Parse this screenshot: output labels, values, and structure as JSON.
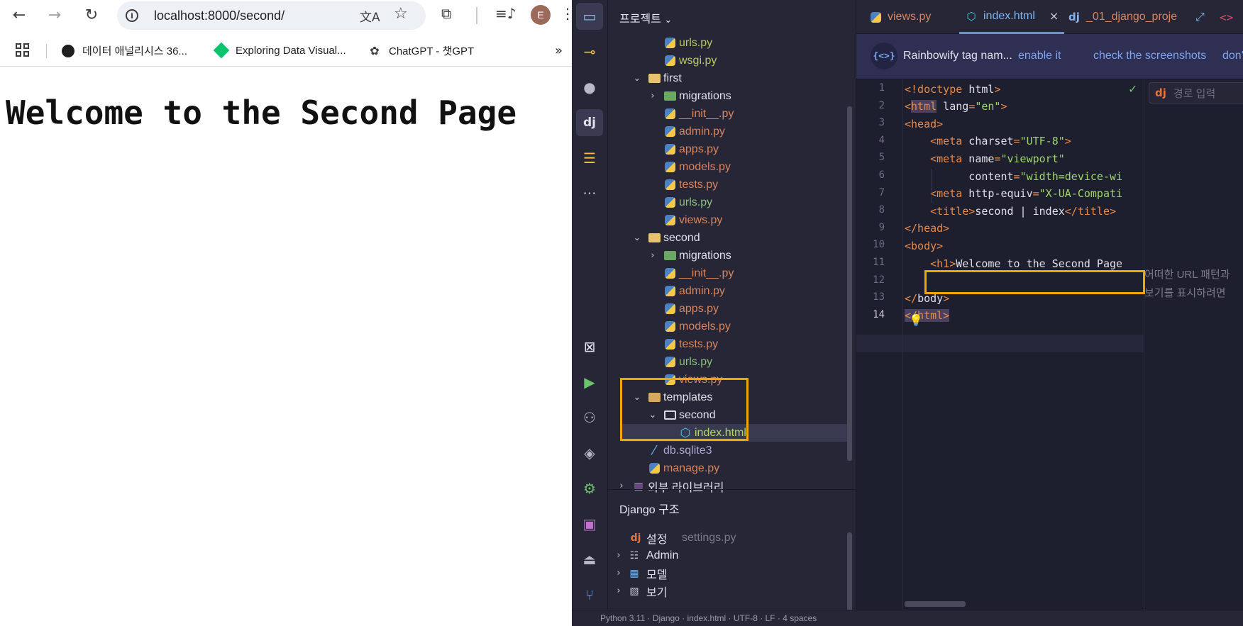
{
  "browser": {
    "url": "localhost:8000/second/",
    "avatar_letter": "E",
    "bookmarks": [
      {
        "label": "데이터 애널리시스 36...",
        "icon": "github-icon"
      },
      {
        "label": "Exploring Data Visual...",
        "icon": "datacamp-icon"
      },
      {
        "label": "ChatGPT - 챗GPT",
        "icon": "openai-icon"
      }
    ],
    "page_heading": "Welcome to the Second Page"
  },
  "ide": {
    "project_title": "프로젝트",
    "tree": [
      {
        "label": "urls.py",
        "indent": 2,
        "type": "py",
        "color": "yellowgreen"
      },
      {
        "label": "wsgi.py",
        "indent": 2,
        "type": "py",
        "color": "yellowgreen"
      },
      {
        "label": "first",
        "indent": 1,
        "type": "folder",
        "expanded": true
      },
      {
        "label": "migrations",
        "indent": 2,
        "type": "migfolder",
        "expanded": false
      },
      {
        "label": "__init__.py",
        "indent": 2,
        "type": "py"
      },
      {
        "label": "admin.py",
        "indent": 2,
        "type": "py"
      },
      {
        "label": "apps.py",
        "indent": 2,
        "type": "py"
      },
      {
        "label": "models.py",
        "indent": 2,
        "type": "py"
      },
      {
        "label": "tests.py",
        "indent": 2,
        "type": "py"
      },
      {
        "label": "urls.py",
        "indent": 2,
        "type": "py",
        "color": "green"
      },
      {
        "label": "views.py",
        "indent": 2,
        "type": "py"
      },
      {
        "label": "second",
        "indent": 1,
        "type": "folder",
        "expanded": true
      },
      {
        "label": "migrations",
        "indent": 2,
        "type": "migfolder",
        "expanded": false
      },
      {
        "label": "__init__.py",
        "indent": 2,
        "type": "py"
      },
      {
        "label": "admin.py",
        "indent": 2,
        "type": "py"
      },
      {
        "label": "apps.py",
        "indent": 2,
        "type": "py"
      },
      {
        "label": "models.py",
        "indent": 2,
        "type": "py"
      },
      {
        "label": "tests.py",
        "indent": 2,
        "type": "py"
      },
      {
        "label": "urls.py",
        "indent": 2,
        "type": "py",
        "color": "green"
      },
      {
        "label": "views.py",
        "indent": 2,
        "type": "py"
      },
      {
        "label": "templates",
        "indent": 1,
        "type": "tplfolder",
        "expanded": true
      },
      {
        "label": "second",
        "indent": 2,
        "type": "outfolder",
        "expanded": true
      },
      {
        "label": "index.html",
        "indent": 3,
        "type": "html",
        "selected": true
      },
      {
        "label": "db.sqlite3",
        "indent": 1,
        "type": "db"
      },
      {
        "label": "manage.py",
        "indent": 1,
        "type": "py"
      },
      {
        "label": "외부 라이브러리",
        "indent": 0,
        "type": "lib",
        "expanded": false
      }
    ],
    "django_struct": {
      "title": "Django 구조",
      "settings_label": "설정",
      "settings_file": "settings.py",
      "items": [
        {
          "label": "Admin",
          "icon": "sliders-icon"
        },
        {
          "label": "모델",
          "icon": "table-icon"
        },
        {
          "label": "보기",
          "icon": "image-icon"
        }
      ]
    },
    "tabs": [
      {
        "label": "views.py",
        "icon": "python-icon"
      },
      {
        "label": "index.html",
        "icon": "html-icon",
        "active": true
      },
      {
        "label": "_01_django_proje",
        "icon": "django-icon"
      }
    ],
    "banner": {
      "text": "Rainbowify tag nam...",
      "enable": "enable it",
      "screenshots": "check the screenshots",
      "dont": "don't"
    },
    "code_lines": [
      [
        {
          "t": "t",
          "v": "<!doctype "
        },
        {
          "t": "a",
          "v": "html"
        },
        {
          "t": "t",
          "v": ">"
        }
      ],
      [
        {
          "t": "t",
          "v": "<"
        },
        {
          "t": "hl",
          "v": "html"
        },
        {
          "t": "a",
          "v": " lang"
        },
        {
          "t": "t",
          "v": "="
        },
        {
          "t": "s",
          "v": "\"en\""
        },
        {
          "t": "t",
          "v": ">"
        }
      ],
      [
        {
          "t": "t",
          "v": "<head>"
        }
      ],
      [
        {
          "t": "a",
          "v": "    "
        },
        {
          "t": "t",
          "v": "<meta"
        },
        {
          "t": "a",
          "v": " charset"
        },
        {
          "t": "t",
          "v": "="
        },
        {
          "t": "s",
          "v": "\"UTF-8\""
        },
        {
          "t": "t",
          "v": ">"
        }
      ],
      [
        {
          "t": "a",
          "v": "    "
        },
        {
          "t": "t",
          "v": "<meta"
        },
        {
          "t": "a",
          "v": " name"
        },
        {
          "t": "t",
          "v": "="
        },
        {
          "t": "s",
          "v": "\"viewport\""
        }
      ],
      [
        {
          "t": "a",
          "v": "          content"
        },
        {
          "t": "t",
          "v": "="
        },
        {
          "t": "s",
          "v": "\"width=device-wi"
        }
      ],
      [
        {
          "t": "a",
          "v": "    "
        },
        {
          "t": "t",
          "v": "<meta"
        },
        {
          "t": "a",
          "v": " http-equiv"
        },
        {
          "t": "t",
          "v": "="
        },
        {
          "t": "s",
          "v": "\"X-UA-Compati"
        }
      ],
      [
        {
          "t": "a",
          "v": "    "
        },
        {
          "t": "t",
          "v": "<title>"
        },
        {
          "t": "a",
          "v": "second | index"
        },
        {
          "t": "t",
          "v": "</title>"
        }
      ],
      [
        {
          "t": "t",
          "v": "</head>"
        }
      ],
      [
        {
          "t": "t",
          "v": "<body>"
        }
      ],
      [
        {
          "t": "a",
          "v": "    "
        },
        {
          "t": "t",
          "v": "<h1>"
        },
        {
          "t": "a",
          "v": "Welcome to the Second Page"
        }
      ],
      [],
      [
        {
          "t": "t",
          "v": "</"
        },
        {
          "t": "a",
          "v": "body"
        },
        {
          "t": "t",
          "v": ">"
        }
      ],
      [
        {
          "t": "hl",
          "v": "</html>"
        }
      ]
    ],
    "path_placeholder": "경로 입력",
    "hint_lines": [
      "어떠한 URL 패턴과",
      "보기를 표시하려면"
    ],
    "status_text": "Python 3.11 · Django · index.html · UTF-8 · LF · 4 spaces"
  }
}
